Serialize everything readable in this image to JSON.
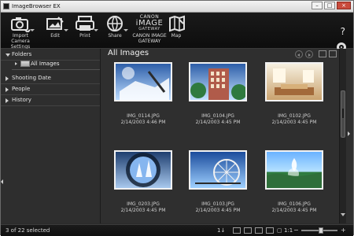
{
  "app": {
    "title": "ImageBrowser EX",
    "window_controls": [
      "minimize",
      "maximize",
      "close"
    ]
  },
  "toolbar": {
    "tools": [
      {
        "id": "import",
        "label": "Import\nCamera Settings",
        "icon": "camera-import-icon",
        "has_dropdown": true
      },
      {
        "id": "edit",
        "label": "Edit",
        "icon": "edit-image-icon",
        "has_dropdown": true
      },
      {
        "id": "print",
        "label": "Print",
        "icon": "printer-icon",
        "has_dropdown": true
      },
      {
        "id": "share",
        "label": "Share",
        "icon": "globe-icon",
        "has_dropdown": true
      },
      {
        "id": "gateway",
        "label": "CANON IMAGE\nGATEWAY",
        "icon": "canon-image-gateway-logo",
        "has_dropdown": false,
        "logo_text_top": "CANON",
        "logo_text_mid": "iMAGE",
        "logo_text_bottom": "GATEWAY"
      },
      {
        "id": "map",
        "label": "Map",
        "icon": "map-icon",
        "has_dropdown": false
      }
    ],
    "help_label": "?",
    "settings_icon": "gear-icon"
  },
  "sidebar": {
    "sections": [
      {
        "label": "Folders",
        "expanded": true
      },
      {
        "label": "Shooting Date",
        "expanded": false
      },
      {
        "label": "People",
        "expanded": false
      },
      {
        "label": "History",
        "expanded": false
      }
    ],
    "folder_item": {
      "label": "All Images",
      "selected": true
    }
  },
  "main": {
    "header_title": "All Images",
    "header_icons": [
      "previous-icon",
      "next-icon",
      "view-toggle-icon",
      "view-toggle-icon-2",
      "trash-icon"
    ],
    "thumbnails": [
      {
        "filename": "IMG_0114.JPG",
        "datetime": "2/14/2003 4:46 PM",
        "image_hint": "blue sky with clouds and a building"
      },
      {
        "filename": "IMG_0104.JPG",
        "datetime": "2/14/2003 4:45 PM",
        "image_hint": "tall building under blue sky with trees"
      },
      {
        "filename": "IMG_0102.JPG",
        "datetime": "2/14/2003 4:45 PM",
        "image_hint": "bright living room interior"
      },
      {
        "filename": "IMG_0203.JPG",
        "datetime": "2/14/2003 4:45 PM",
        "image_hint": "view through round window"
      },
      {
        "filename": "IMG_0103.JPG",
        "datetime": "2/14/2003 4:45 PM",
        "image_hint": "ferris wheel against blue sky"
      },
      {
        "filename": "IMG_0106.JPG",
        "datetime": "2/14/2003 4:45 PM",
        "image_hint": "fountain in a park"
      }
    ]
  },
  "status": {
    "selection_text": "3 of 22 selected",
    "zoom_minus": "−",
    "zoom_plus": "+",
    "zoom_level": 0.55
  },
  "colors": {
    "window_bg": "#2b2b2b",
    "toolbar_bg": "#111111",
    "sidebar_bg": "#2e2e2e",
    "main_bg": "#2f2f2f",
    "titlebar_bg": "#e6e6e6",
    "close_red": "#c94b3c",
    "text_light": "#e2e2e2"
  }
}
